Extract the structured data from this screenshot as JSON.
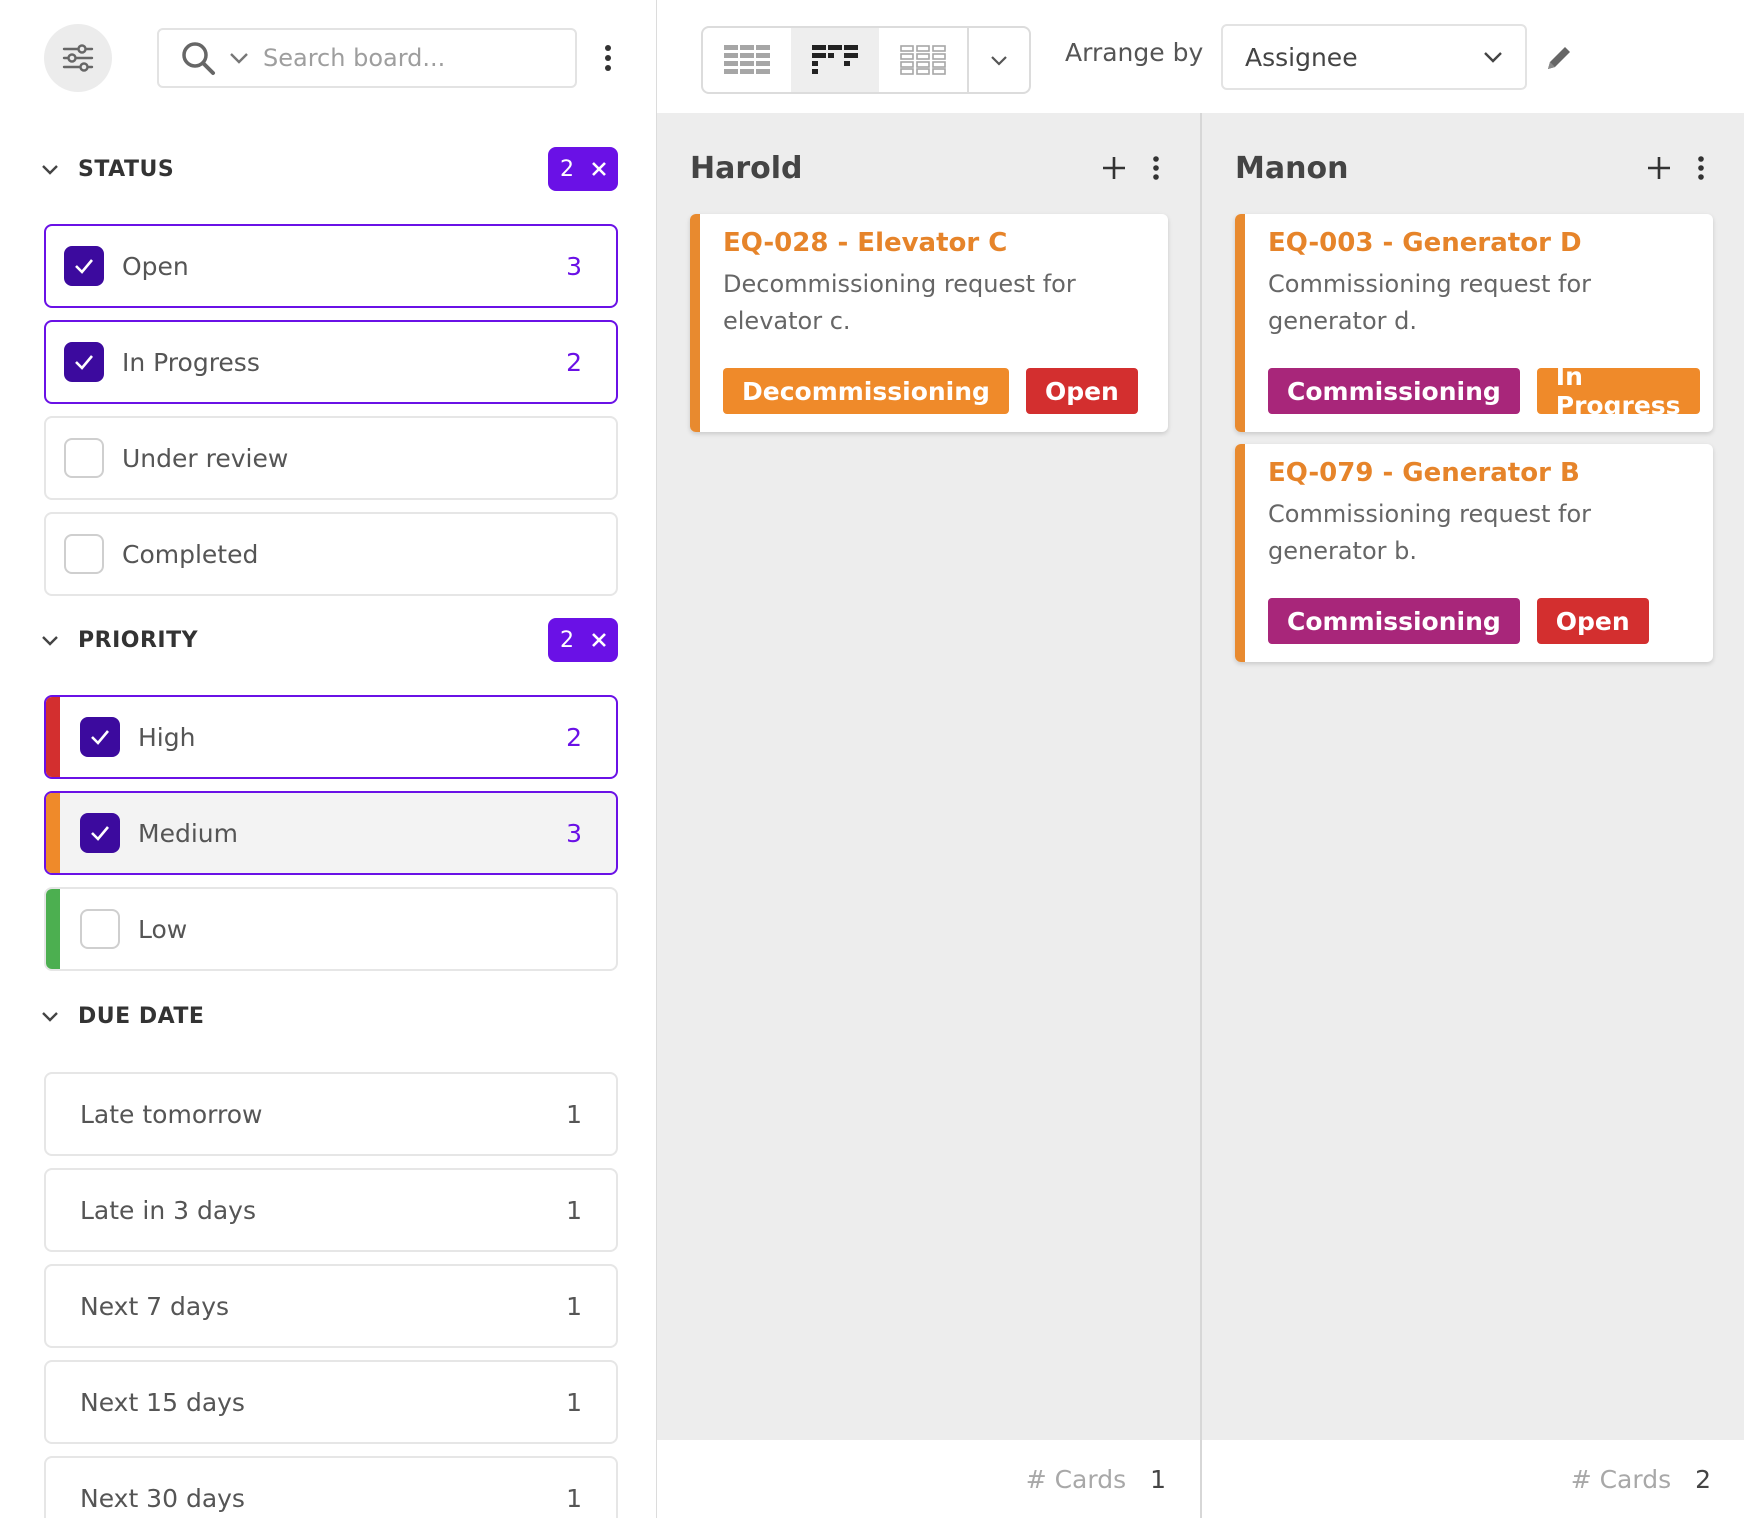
{
  "sidebar": {
    "filter_icon": "sliders-icon",
    "search": {
      "placeholder": "Search board..."
    },
    "status": {
      "title": "STATUS",
      "chip_count": "2",
      "options": [
        {
          "label": "Open",
          "count": "3",
          "checked": true
        },
        {
          "label": "In Progress",
          "count": "2",
          "checked": true
        },
        {
          "label": "Under review",
          "count": "",
          "checked": false
        },
        {
          "label": "Completed",
          "count": "",
          "checked": false
        }
      ]
    },
    "priority": {
      "title": "PRIORITY",
      "chip_count": "2",
      "options": [
        {
          "label": "High",
          "count": "2",
          "checked": true,
          "color": "#d32f2f"
        },
        {
          "label": "Medium",
          "count": "3",
          "checked": true,
          "color": "#ef8a2a"
        },
        {
          "label": "Low",
          "count": "",
          "checked": false,
          "color": "#4caf50"
        }
      ]
    },
    "due_date": {
      "title": "DUE DATE",
      "options": [
        {
          "label": "Late tomorrow",
          "count": "1"
        },
        {
          "label": "Late in 3 days",
          "count": "1"
        },
        {
          "label": "Next 7 days",
          "count": "1"
        },
        {
          "label": "Next 15 days",
          "count": "1"
        },
        {
          "label": "Next 30 days",
          "count": "1"
        }
      ]
    }
  },
  "toolbar": {
    "arrange_label": "Arrange by",
    "arrange_value": "Assignee"
  },
  "columns": [
    {
      "name": "Harold",
      "footer_label": "# Cards",
      "footer_count": "1",
      "cards": [
        {
          "title": "EQ-028 - Elevator C",
          "description": "Decommissioning request for elevator c.",
          "tags": [
            {
              "label": "Decommissioning",
              "color": "#ef8a2a"
            },
            {
              "label": "Open",
              "color": "#d32f2f"
            }
          ]
        }
      ]
    },
    {
      "name": "Manon",
      "footer_label": "# Cards",
      "footer_count": "2",
      "cards": [
        {
          "title": "EQ-003 - Generator D",
          "description": "Commissioning request for generator d.",
          "tags": [
            {
              "label": "Commissioning",
              "color": "#a8267a"
            },
            {
              "label": "In Progress",
              "color": "#ef8a2a"
            }
          ]
        },
        {
          "title": "EQ-079 - Generator B",
          "description": "Commissioning request for generator b.",
          "tags": [
            {
              "label": "Commissioning",
              "color": "#a8267a"
            },
            {
              "label": "Open",
              "color": "#d32f2f"
            }
          ]
        }
      ]
    }
  ],
  "colors": {
    "accent": "#6a11e6",
    "checkbox": "#3c0a9e",
    "card_title": "#e6842a",
    "card_edge": "#e88a2f"
  }
}
